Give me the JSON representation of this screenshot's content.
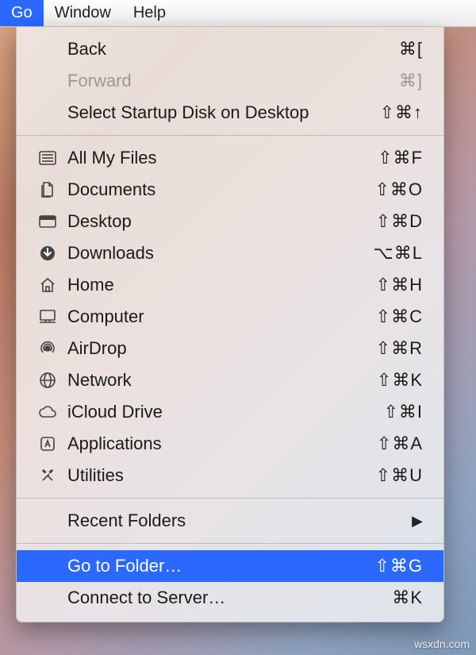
{
  "menubar": {
    "items": [
      {
        "label": "Go",
        "active": true
      },
      {
        "label": "Window",
        "active": false
      },
      {
        "label": "Help",
        "active": false
      }
    ]
  },
  "menu": {
    "back": {
      "label": "Back",
      "shortcut": "⌘["
    },
    "forward": {
      "label": "Forward",
      "shortcut": "⌘]"
    },
    "startup": {
      "label": "Select Startup Disk on Desktop",
      "shortcut": "⇧⌘↑"
    },
    "allfiles": {
      "label": "All My Files",
      "shortcut": "⇧⌘F"
    },
    "documents": {
      "label": "Documents",
      "shortcut": "⇧⌘O"
    },
    "desktop": {
      "label": "Desktop",
      "shortcut": "⇧⌘D"
    },
    "downloads": {
      "label": "Downloads",
      "shortcut": "⌥⌘L"
    },
    "home": {
      "label": "Home",
      "shortcut": "⇧⌘H"
    },
    "computer": {
      "label": "Computer",
      "shortcut": "⇧⌘C"
    },
    "airdrop": {
      "label": "AirDrop",
      "shortcut": "⇧⌘R"
    },
    "network": {
      "label": "Network",
      "shortcut": "⇧⌘K"
    },
    "icloud": {
      "label": "iCloud Drive",
      "shortcut": "⇧⌘I"
    },
    "apps": {
      "label": "Applications",
      "shortcut": "⇧⌘A"
    },
    "utilities": {
      "label": "Utilities",
      "shortcut": "⇧⌘U"
    },
    "recent": {
      "label": "Recent Folders"
    },
    "gotofolder": {
      "label": "Go to Folder…",
      "shortcut": "⇧⌘G"
    },
    "connect": {
      "label": "Connect to Server…",
      "shortcut": "⌘K"
    }
  },
  "watermark": "wsxdn.com"
}
